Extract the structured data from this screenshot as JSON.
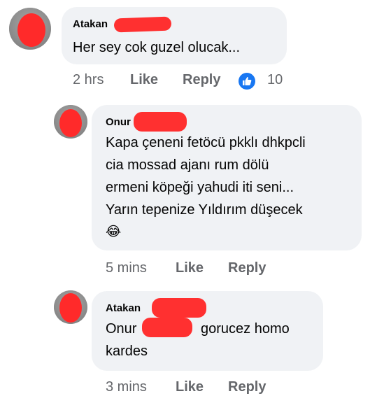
{
  "comments": [
    {
      "author": "Atakan",
      "text": "Her sey cok guzel olucak...",
      "time": "2 hrs",
      "like_label": "Like",
      "reply_label": "Reply",
      "reaction_count": "10"
    },
    {
      "author": "Onur",
      "text_lines": [
        "Kapa çeneni fetöcü pkklı dhkpcli",
        "cia mossad ajanı rum dölü",
        "ermeni köpeği yahudi iti seni...",
        "Yarın tepenize Yıldırım düşecek"
      ],
      "emoji": "😂",
      "time": "5 mins",
      "like_label": "Like",
      "reply_label": "Reply"
    },
    {
      "author": "Atakan",
      "text_line1_start": "Onur",
      "text_line1_end": "gorucez homo",
      "text_line2": "kardes",
      "time": "3 mins",
      "like_label": "Like",
      "reply_label": "Reply"
    }
  ],
  "colors": {
    "bubble": "#f0f2f5",
    "meta_text": "#65676b",
    "like_badge": "#1877f2",
    "redaction": "#ff2a2a"
  }
}
